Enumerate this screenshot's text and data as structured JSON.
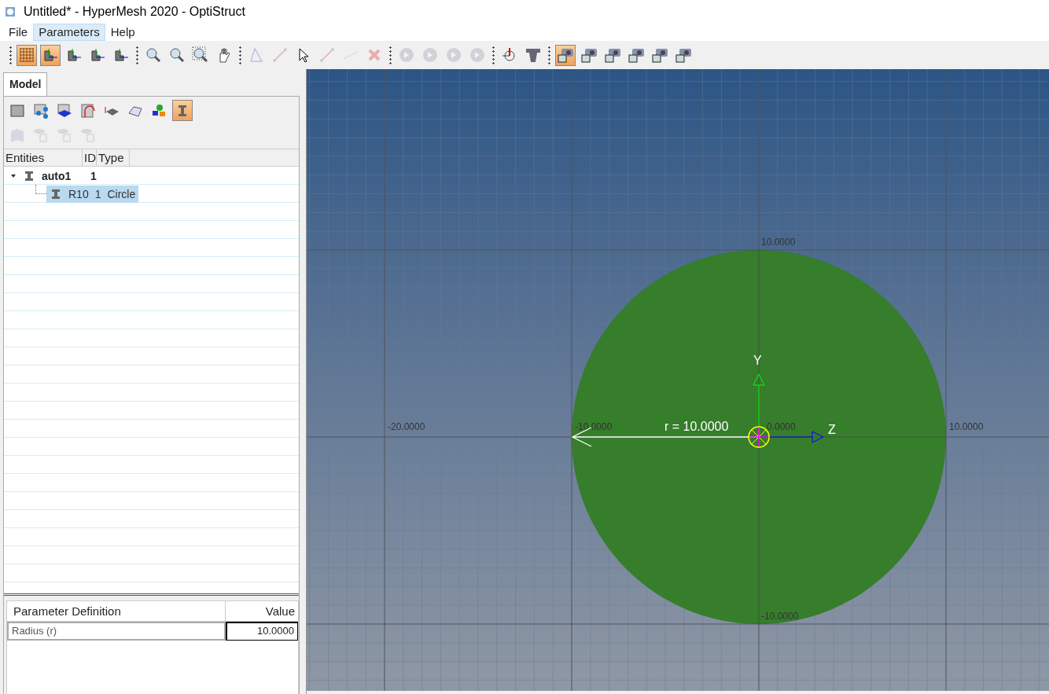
{
  "window": {
    "title": "Untitled* - HyperMesh 2020 - OptiStruct"
  },
  "menu": [
    {
      "label": "File",
      "selected": false
    },
    {
      "label": "Parameters",
      "selected": true
    },
    {
      "label": "Help",
      "selected": false
    }
  ],
  "toolbar": [
    [
      {
        "kind": "grid",
        "selected": true,
        "disabled": false
      },
      {
        "kind": "view",
        "selected": true,
        "disabled": false
      },
      {
        "kind": "view",
        "selected": false,
        "disabled": false
      },
      {
        "kind": "view",
        "selected": false,
        "disabled": false
      },
      {
        "kind": "view",
        "selected": false,
        "disabled": false
      }
    ],
    [
      {
        "kind": "zoom-in",
        "selected": false,
        "disabled": false
      },
      {
        "kind": "zoom-out",
        "selected": false,
        "disabled": false
      },
      {
        "kind": "zoom-box",
        "selected": false,
        "disabled": false
      },
      {
        "kind": "pan",
        "selected": false,
        "disabled": false
      }
    ],
    [
      {
        "kind": "triangle",
        "selected": false,
        "disabled": true
      },
      {
        "kind": "line",
        "selected": false,
        "disabled": true
      },
      {
        "kind": "pointer",
        "selected": false,
        "disabled": false
      },
      {
        "kind": "line",
        "selected": false,
        "disabled": true
      },
      {
        "kind": "dashed",
        "selected": false,
        "disabled": true
      },
      {
        "kind": "delete",
        "selected": false,
        "disabled": true
      }
    ],
    [
      {
        "kind": "first",
        "selected": false,
        "disabled": true
      },
      {
        "kind": "prev",
        "selected": false,
        "disabled": true
      },
      {
        "kind": "next",
        "selected": false,
        "disabled": true
      },
      {
        "kind": "last",
        "selected": false,
        "disabled": true
      }
    ],
    [
      {
        "kind": "triad",
        "selected": false,
        "disabled": false
      },
      {
        "kind": "ruler",
        "selected": false,
        "disabled": false
      }
    ],
    [
      {
        "kind": "camera",
        "selected": true,
        "disabled": false
      },
      {
        "kind": "camera",
        "selected": false,
        "disabled": false
      },
      {
        "kind": "camera",
        "selected": false,
        "disabled": false
      },
      {
        "kind": "camera",
        "selected": false,
        "disabled": false
      },
      {
        "kind": "camera",
        "selected": false,
        "disabled": false
      },
      {
        "kind": "camera",
        "selected": false,
        "disabled": false
      }
    ]
  ],
  "panel": {
    "tabs": [
      {
        "label": "Model",
        "selected": true
      }
    ],
    "tools": [
      [
        {
          "kind": "folder",
          "selected": false,
          "disabled": false
        },
        {
          "kind": "connectors",
          "selected": false,
          "disabled": false
        },
        {
          "kind": "solid",
          "selected": false,
          "disabled": false
        },
        {
          "kind": "curve",
          "selected": false,
          "disabled": false
        },
        {
          "kind": "thickness",
          "selected": false,
          "disabled": false
        },
        {
          "kind": "mesh",
          "selected": false,
          "disabled": false
        },
        {
          "kind": "parts",
          "selected": false,
          "disabled": false
        },
        {
          "kind": "beam",
          "selected": true,
          "disabled": false
        }
      ],
      [
        {
          "kind": "surface",
          "selected": false,
          "disabled": true
        },
        {
          "kind": "visibility",
          "selected": false,
          "disabled": true
        },
        {
          "kind": "visibility",
          "selected": false,
          "disabled": true
        },
        {
          "kind": "visibility",
          "selected": false,
          "disabled": true
        }
      ]
    ],
    "tree": {
      "columns": [
        "Entities",
        "ID",
        "Type"
      ],
      "rows": [
        {
          "name": "auto1",
          "id": "1",
          "expanded": true,
          "selected": false,
          "children": [
            {
              "name": "R10",
              "id": "1",
              "type": "Circle",
              "selected": true
            }
          ]
        }
      ]
    },
    "parameters": {
      "columns": [
        "Parameter Definition",
        "Value"
      ],
      "rows": [
        {
          "label": "Radius (r)",
          "value": "10.0000"
        }
      ]
    }
  },
  "viewport": {
    "x_ticks": [
      "-20.0000",
      "-10.0000",
      "0.0000",
      "10.0000"
    ],
    "y_ticks": [
      "10.0000",
      "-10.0000"
    ],
    "axes": [
      "Y",
      "Z"
    ],
    "dimension": "r = 10.0000"
  }
}
